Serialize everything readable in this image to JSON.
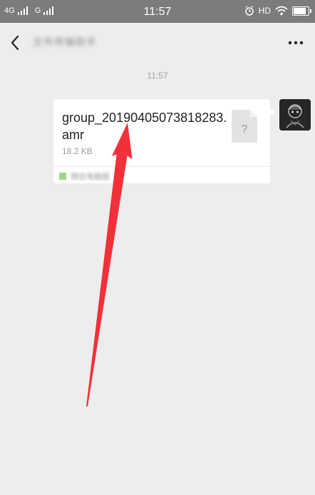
{
  "status_bar": {
    "network_1": "4G",
    "network_2": "G",
    "time": "11:57",
    "hd_label": "HD"
  },
  "header": {
    "title": "文件传输助手",
    "back_icon": "chevron-left-icon",
    "more_icon": "more-horizontal-icon"
  },
  "chat": {
    "timestamp": "11:57",
    "message": {
      "file_name": "group_20190405073818283.amr",
      "file_size": "18.2 KB",
      "file_type_icon": "unknown-file-icon",
      "file_icon_glyph": "?",
      "source_label": "微信电脑版"
    }
  },
  "annotation": {
    "arrow_color": "#f2303a"
  }
}
